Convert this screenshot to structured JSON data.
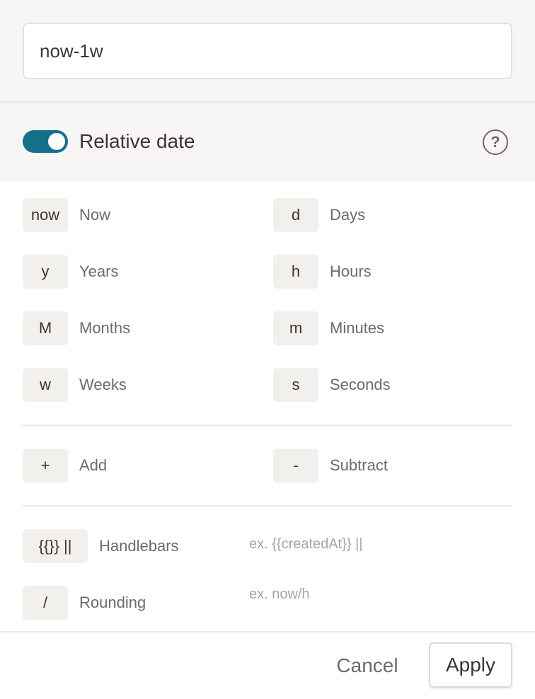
{
  "input": {
    "value": "now-1w"
  },
  "toggle": {
    "label": "Relative date",
    "on": true,
    "help_icon": "question-circle-icon",
    "help_symbol": "?"
  },
  "units": [
    {
      "key": "now",
      "label": "Now"
    },
    {
      "key": "d",
      "label": "Days"
    },
    {
      "key": "y",
      "label": "Years"
    },
    {
      "key": "h",
      "label": "Hours"
    },
    {
      "key": "M",
      "label": "Months"
    },
    {
      "key": "m",
      "label": "Minutes"
    },
    {
      "key": "w",
      "label": "Weeks"
    },
    {
      "key": "s",
      "label": "Seconds"
    }
  ],
  "operators": [
    {
      "key": "+",
      "label": "Add"
    },
    {
      "key": "-",
      "label": "Subtract"
    }
  ],
  "handlebars": {
    "key": "{{}} ||",
    "label": "Handlebars",
    "hint": "ex. {{createdAt}} ||"
  },
  "rounding": {
    "key": "/",
    "label": "Rounding",
    "hint": "ex. now/h"
  },
  "footer": {
    "cancel_label": "Cancel",
    "apply_label": "Apply"
  },
  "colors": {
    "accent": "#14708a",
    "background": "#f7f6f4",
    "chip": "#f2f0ed"
  }
}
